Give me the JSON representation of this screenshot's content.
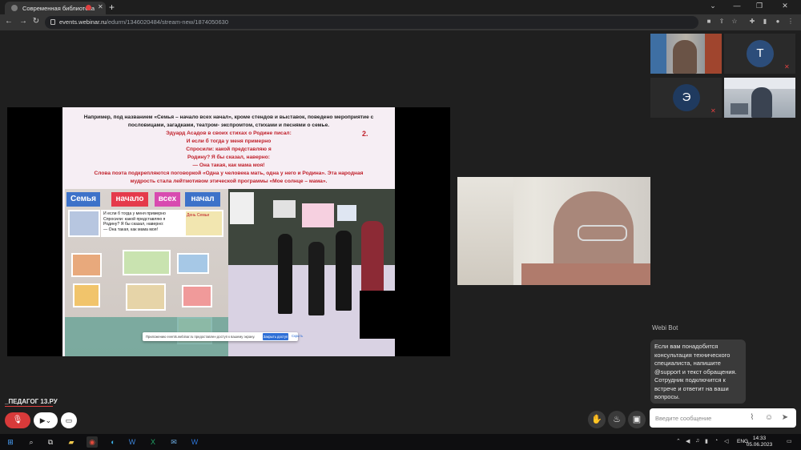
{
  "browser": {
    "tab_title": "Современная библиотека",
    "url_host": "events.webinar.ru",
    "url_path": "/edurm/1346020484/stream-new/1874050630"
  },
  "slide": {
    "line1": "Например, под названием «Семья – начало всех начал», кроме стендов и выставок, поведено мероприятие с",
    "line2": "пословицами, загадками,  театром- экспромтом, стихами и песнями о семье.",
    "red1": "Эдуард Асадов в своих стихах о Родине писал:",
    "red2": "И если б тогда у меня примерно",
    "red3": "Спросили: какой представляю я",
    "red4": "Родину? Я бы сказал, наверно:",
    "red5": "— Она такая, как мама моя!",
    "red6": "Слова поэта подкрепляются поговоркой «Одна  у человека мать, одна у него и Родина». Эта народная",
    "red7": "мудрость стала лейтмотивом этической программы   «Мое солнце – мама».",
    "number": "2.",
    "banner_words": [
      "Семья",
      "начало",
      "всех",
      "начал"
    ],
    "poem_lines": [
      "И если б тогда у меня примерно",
      "Спросили: какой представляю я",
      "Родину? Я бы сказал, наверно:",
      "— Она такая, как мама моя!"
    ],
    "stand_label": "День Семьи"
  },
  "access_prompt": {
    "text": "Приложению events.webinar.ru предоставлен доступ к вашему экрану.",
    "close_button": "Закрыть доступ",
    "hide_link": "Скрыть"
  },
  "participants": [
    {
      "initial": "",
      "muted": false
    },
    {
      "initial": "Т",
      "muted": true
    },
    {
      "initial": "Э",
      "muted": true
    },
    {
      "initial": "",
      "muted": false
    }
  ],
  "chat": {
    "bot_name": "Webi Bot",
    "bot_message": "Если вам понадобится консультация технического специалиста, напишите @support и текст обращения. Сотрудник подключится к встрече и ответит на ваши вопросы.",
    "input_placeholder": "Введите сообщение"
  },
  "brand": "_ПЕДАГОГ 13.РУ",
  "taskbar": {
    "lang": "ENG",
    "time": "14:33",
    "date": "05.06.2023"
  },
  "colors": {
    "background": "#1f1f1f",
    "mic_muted": "#d83a3a",
    "slide_red": "#c0202a",
    "avatar_t": "#2c4d7a",
    "avatar_e": "#1f3a5f"
  }
}
